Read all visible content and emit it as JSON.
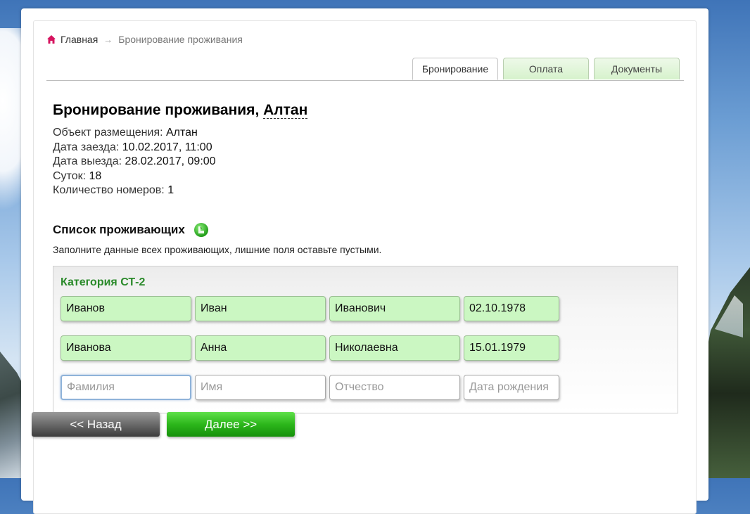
{
  "breadcrumb": {
    "home": "Главная",
    "separator": "→",
    "current": "Бронирование проживания"
  },
  "tabs": [
    {
      "label": "Бронирование",
      "active": true
    },
    {
      "label": "Оплата",
      "active": false
    },
    {
      "label": "Документы",
      "active": false
    }
  ],
  "title": {
    "prefix": "Бронирование проживания,",
    "object_link": "Алтан"
  },
  "info": {
    "object_label": "Объект размещения:",
    "object_value": "Алтан",
    "checkin_label": "Дата заезда:",
    "checkin_value": "10.02.2017, 11:00",
    "checkout_label": "Дата выезда:",
    "checkout_value": "28.02.2017, 09:00",
    "days_label": "Суток:",
    "days_value": "18",
    "rooms_label": "Количество номеров:",
    "rooms_value": "1"
  },
  "guests": {
    "title": "Список проживающих",
    "hint": "Заполните данные всех проживающих, лишние поля оставьте пустыми.",
    "category": "Категория СТ-2",
    "rows": [
      {
        "last_name": "Иванов",
        "first_name": "Иван",
        "middle_name": "Иванович",
        "birth_date": "02.10.1978"
      },
      {
        "last_name": "Иванова",
        "first_name": "Анна",
        "middle_name": "Николаевна",
        "birth_date": "15.01.1979"
      }
    ],
    "placeholders": {
      "last_name": "Фамилия",
      "first_name": "Имя",
      "middle_name": "Отчество",
      "birth_date": "Дата рождения"
    }
  },
  "buttons": {
    "back": "<< Назад",
    "next": "Далее >>"
  },
  "colors": {
    "accent_green": "#2cb61b",
    "field_filled": "#cbf7c2",
    "category_text": "#2a8a2a",
    "home_icon": "#d6145f"
  }
}
